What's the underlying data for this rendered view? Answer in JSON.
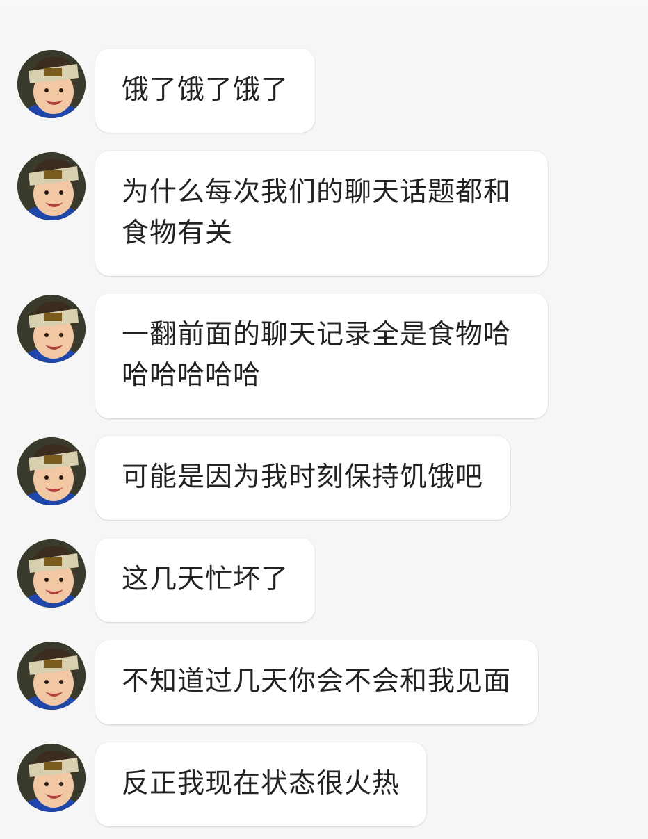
{
  "chat": {
    "messages": [
      {
        "sender": "contact",
        "avatar_icon": "child-avatar-icon",
        "text": "饿了饿了饿了"
      },
      {
        "sender": "contact",
        "avatar_icon": "child-avatar-icon",
        "text": "为什么每次我们的聊天话题都和食物有关"
      },
      {
        "sender": "contact",
        "avatar_icon": "child-avatar-icon",
        "text": "一翻前面的聊天记录全是食物哈哈哈哈哈哈"
      },
      {
        "sender": "contact",
        "avatar_icon": "child-avatar-icon",
        "text": "可能是因为我时刻保持饥饿吧"
      },
      {
        "sender": "contact",
        "avatar_icon": "child-avatar-icon",
        "text": "这几天忙坏了"
      },
      {
        "sender": "contact",
        "avatar_icon": "child-avatar-icon",
        "text": "不知道过几天你会不会和我见面"
      },
      {
        "sender": "contact",
        "avatar_icon": "child-avatar-icon",
        "text": "反正我现在状态很火热"
      }
    ]
  },
  "colors": {
    "background": "#f6f6f6",
    "bubble": "#ffffff",
    "text": "#222222"
  }
}
